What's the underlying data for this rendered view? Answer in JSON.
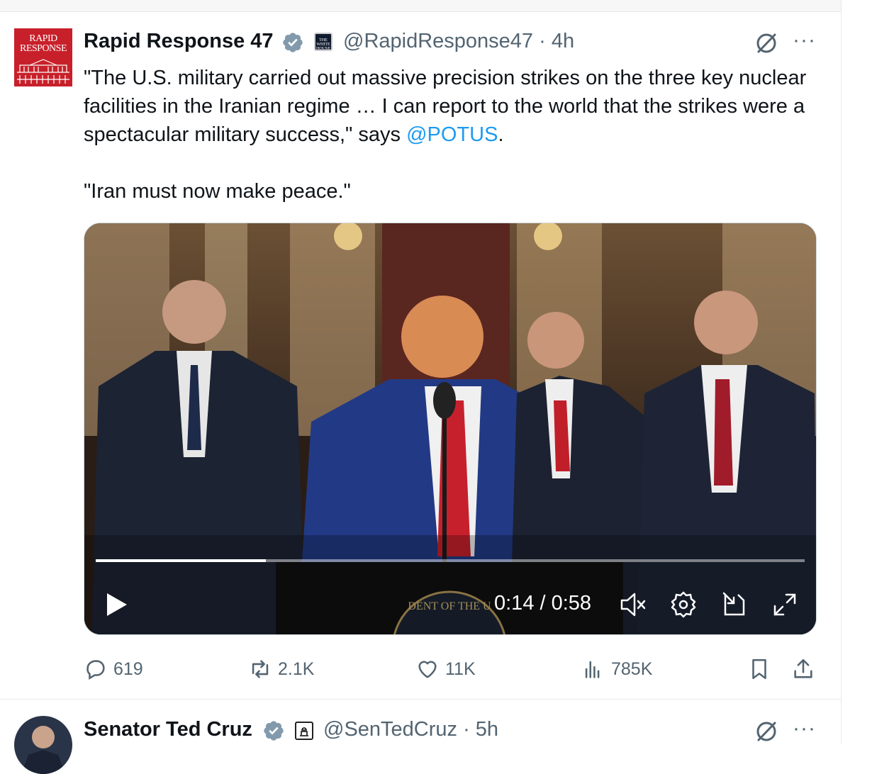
{
  "tweet": {
    "avatar_text": "RAPID RESPONSE",
    "display_name": "Rapid Response 47",
    "handle_time": "@RapidResponse47 · 4h",
    "affiliation_badge": "THE WHITE HOUSE",
    "text_part1": "\"The U.S. military carried out massive precision strikes on the three key nuclear facilities in the Iranian regime … I can report to the world that the strikes were a spectacular military success,\" says ",
    "mention": "@POTUS",
    "text_part2": ".\n\n\"Iran must now make peace.\"",
    "video": {
      "progress": 0.24,
      "time": "0:14 / 0:58",
      "seal_text": "DENT OF THE U"
    },
    "actions": {
      "replies": "619",
      "reposts": "2.1K",
      "likes": "11K",
      "views": "785K"
    }
  },
  "next_tweet": {
    "display_name": "Senator Ted Cruz",
    "handle_time": "@SenTedCruz · 5h"
  },
  "colors": {
    "accent": "#1d9bf0",
    "verified": "#829aab",
    "secondary_text": "#536471",
    "avatar_red": "#c8202a"
  },
  "icons": [
    "verified-badge-icon",
    "grok-icon",
    "more-icon",
    "play-icon",
    "mute-icon",
    "settings-icon",
    "pip-icon",
    "fullscreen-icon",
    "reply-icon",
    "repost-icon",
    "like-icon",
    "views-icon",
    "bookmark-icon",
    "share-icon"
  ]
}
